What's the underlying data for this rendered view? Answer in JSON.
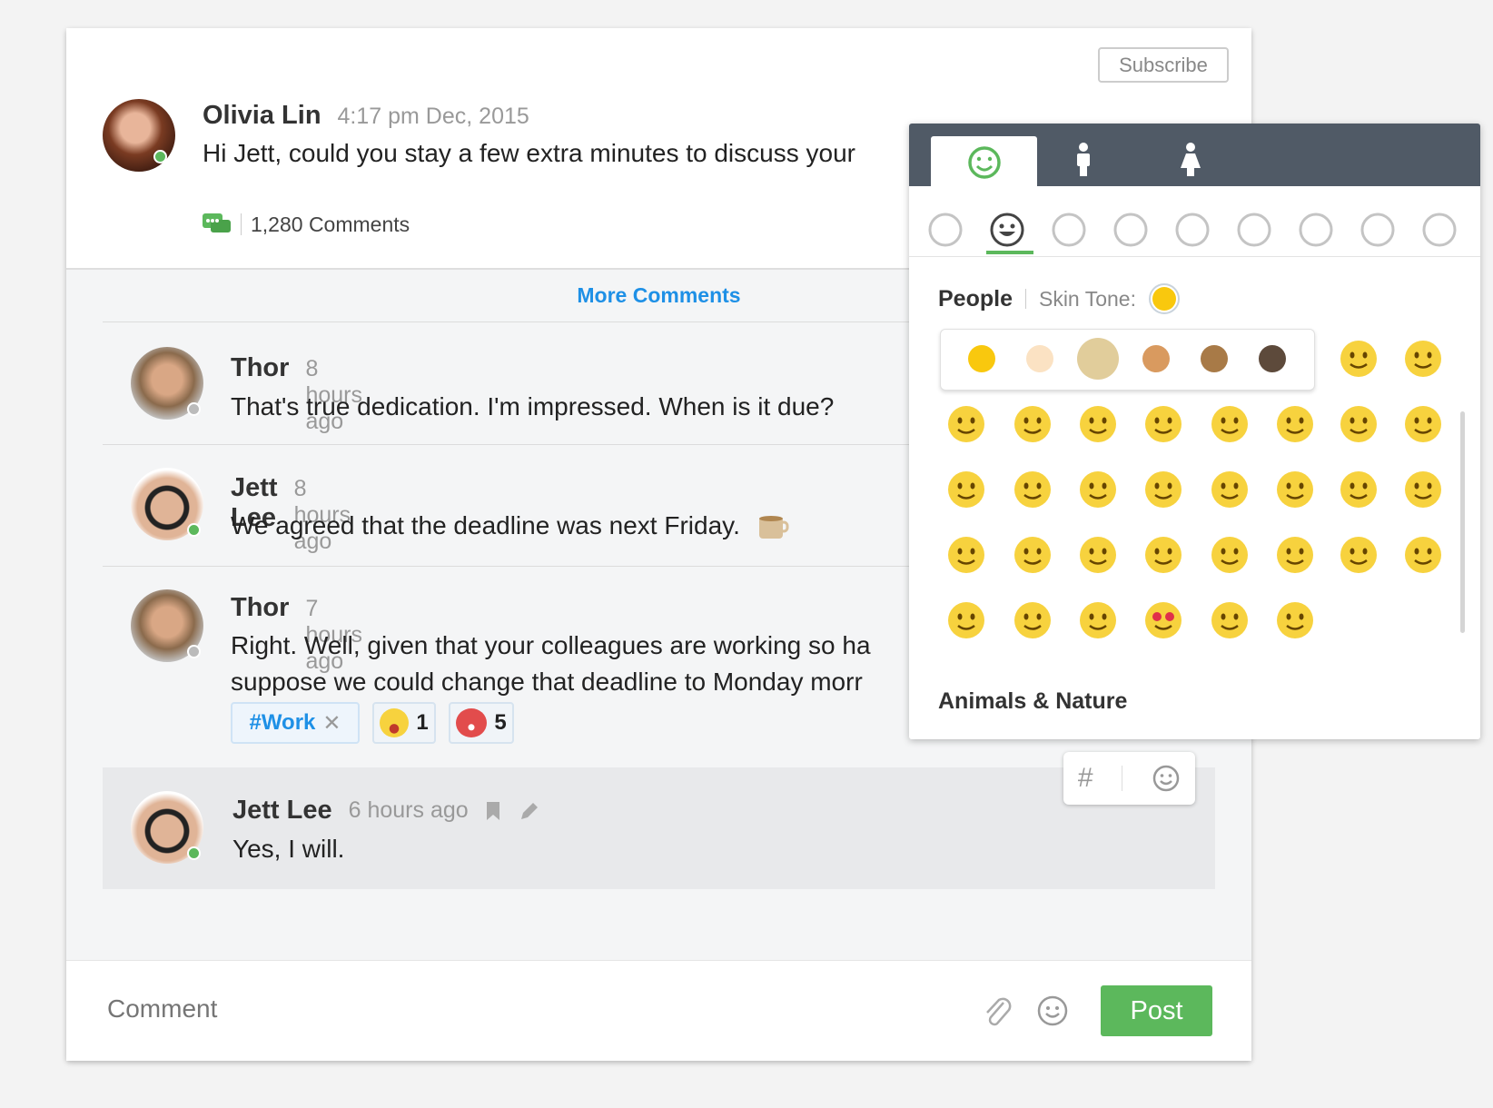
{
  "post": {
    "author": "Olivia Lin",
    "time": "4:17 pm Dec, 2015",
    "message": "Hi Jett, could you stay a few extra minutes to discuss your",
    "comments_count": "1,280 Comments",
    "subscribe_label": "Subscribe",
    "status": "online"
  },
  "more_comments_label": "More Comments",
  "comments": [
    {
      "author": "Thor",
      "time": "8 hours ago",
      "lines": [
        "That's true dedication. I'm impressed. When is it due?"
      ],
      "status": "offline"
    },
    {
      "author": "Jett Lee",
      "time": "8 hours ago",
      "lines": [
        "We agreed that the deadline was next Friday."
      ],
      "status": "online",
      "inline_icon": "coffee-icon"
    },
    {
      "author": "Thor",
      "time": "7 hours ago",
      "lines": [
        "Right. Well, given that your colleagues are working so ha",
        "suppose we could change that deadline to Monday morr"
      ],
      "status": "offline",
      "tag": "#Work",
      "reactions": [
        {
          "icon": "astonished-face",
          "count": "1"
        },
        {
          "icon": "devil-face",
          "count": "5"
        }
      ]
    },
    {
      "author": "Jett Lee",
      "time": "6 hours ago",
      "lines": [
        "Yes, I will."
      ],
      "status": "online",
      "highlighted": true
    }
  ],
  "composer": {
    "placeholder": "Comment",
    "post_label": "Post"
  },
  "emoji_panel": {
    "tabs": [
      "smiley-icon",
      "man-icon",
      "woman-icon"
    ],
    "active_tab": 0,
    "categories": [
      "recent",
      "people",
      "animals",
      "food",
      "sports",
      "travel",
      "objects",
      "symbols",
      "flags"
    ],
    "active_category": 1,
    "section_title": "People",
    "skin_tone_label": "Skin Tone:",
    "skin_tones": [
      "#f9c80e",
      "#fbe2c3",
      "#e1cd9b",
      "#d99a5f",
      "#a87a47",
      "#5d4a3b"
    ],
    "selected_tone": 2,
    "emojis": [
      "blush",
      "wink-tongue",
      "rolling-eyes",
      "kissing-closed-eyes",
      "kissing-heart",
      "tongue-wink",
      "cold-sweat",
      "neutral",
      "flushed",
      "innocent",
      "expressionless",
      "thinking",
      "grimacing",
      "sunglasses",
      "dizzy-blush",
      "crying",
      "laughing",
      "hugging",
      "upside-down",
      "yum",
      "nerd",
      "scream",
      "frowning",
      "sleeping",
      "no-mouth",
      "triumph",
      "grinning-squint",
      "lying",
      "old-woman",
      "heart-eyes",
      "zipper-mouth",
      "grinning"
    ],
    "next_section": "Animals & Nature"
  },
  "popup_icons": [
    "hash-icon",
    "smiley-icon"
  ],
  "colors": {
    "accent": "#5cb85c",
    "link": "#1e90e6",
    "panel_header": "#505a66"
  }
}
